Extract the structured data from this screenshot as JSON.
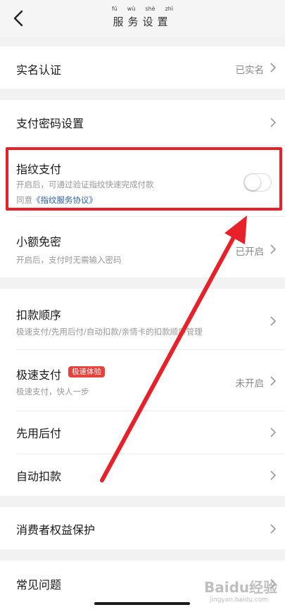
{
  "header": {
    "pinyin": [
      "fú",
      "wù",
      "shè",
      "zhì"
    ],
    "title": "服务设置"
  },
  "rows": {
    "realname": {
      "title": "实名认证",
      "value": "已实名"
    },
    "paypassword": {
      "title": "支付密码设置"
    },
    "fingerprint": {
      "title": "指纹支付",
      "subtitle": "开启后，可通过验证指纹快速完成付款",
      "agreement_prefix": "同意",
      "agreement_link": "《指纹服务协议》",
      "enabled": false
    },
    "smallamount": {
      "title": "小额免密",
      "subtitle": "开启后，支付时无需输入密码",
      "value": "已开启"
    },
    "deduction": {
      "title": "扣款顺序",
      "subtitle": "极速支付/先用后付/自动扣款/亲情卡的扣款顺序管理"
    },
    "quickpay": {
      "title": "极速支付",
      "badge": "极速体验",
      "subtitle": "极速支付，快人一步",
      "value": "未开启"
    },
    "payafter": {
      "title": "先用后付"
    },
    "autodeduct": {
      "title": "自动扣款"
    },
    "consumer": {
      "title": "消费者权益保护"
    },
    "faq": {
      "title": "常见问题"
    }
  },
  "watermark": {
    "text": "Baidu经验",
    "sub": "jingyan.baidu.com"
  },
  "colors": {
    "highlight": "#e62129",
    "link": "#2c5fa8",
    "badge": "#e8403a"
  }
}
